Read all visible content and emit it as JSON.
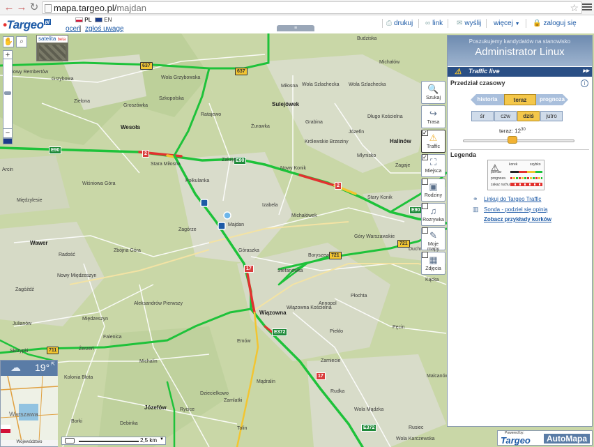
{
  "browser": {
    "url_host": "mapa.targeo.pl/",
    "url_path": "majdan"
  },
  "header": {
    "logo": "Targeo",
    "logo_suffix": "pl",
    "links": {
      "ocen": "oceń",
      "separator": "|",
      "uwagi": "zgłoś uwagę"
    },
    "lang_pl": "PL",
    "lang_en": "EN",
    "tools": {
      "print": "drukuj",
      "link": "link",
      "send": "wyślij",
      "more": "więcej",
      "login": "zaloguj się"
    },
    "collapse": "≡"
  },
  "map": {
    "satellite_label": "satelita",
    "satellite_new": "beta",
    "weather_temp": "19°",
    "weather_city": "Warszawa",
    "weather_caption": "Województwo",
    "scale": "2,5 km",
    "roads": {
      "e90_a": "E90",
      "e90_b": "E90",
      "e90_c": "E90",
      "r637a": "637",
      "r637b": "637",
      "r721a": "721",
      "r721b": "721",
      "r711": "711",
      "r17a": "17",
      "r17b": "17",
      "r2a": "2",
      "r2b": "2",
      "e372a": "E372",
      "e372b": "E372"
    },
    "places": {
      "nowy_rembertow": "Nowy Rembertów",
      "grzybowa": "Grzybowa",
      "zielona": "Zielona",
      "wola_grzybowska": "Wola Grzybowska",
      "szkopolska": "Szkopolska",
      "groszowka": "Groszówka",
      "wesola": "Wesoła",
      "ratajewo": "Ratajewo",
      "milosna": "Miłosna",
      "wola_szlachecka": "Wola Szlachecka",
      "sulejowek": "Sulejówek",
      "zurawka": "Żurawka",
      "budziska": "Budziska",
      "michalow": "Michałów",
      "dlugo": "Długo Kościelna",
      "grabina": "Grabina",
      "krolewskie": "Królewskie Brzeziny",
      "jozefin": "Józefin",
      "halinow": "Halinów",
      "mlynisko": "Mlynisko",
      "zagaje": "Zagaje",
      "stara_milosna": "Stara Miłosna",
      "zakret": "Zakręt",
      "nowy_konik": "Nowy Konik",
      "stary_konik": "Stary Konik",
      "wisniowa": "Wiśniowa Góra",
      "miedzylesie": "Międzylesie",
      "polkulanka": "Połkulanka",
      "izabela": "Izabela",
      "michalowek": "Michałówek",
      "majdan": "Majdan",
      "zagorze": "Zagórze",
      "wawer": "Wawer",
      "radosc": "Radość",
      "zbojna": "Zbójna Góra",
      "goraszka": "Góraszka",
      "gory": "Góry Warszawskie",
      "boryszew": "Boryszew",
      "duchnow": "Duchnów",
      "stefanowka": "Stefanówka",
      "nowy_miedzeszyn": "Nowy Międzeszyn",
      "zagozdz": "Zagóźdź",
      "aleksandrow": "Aleksandrów Pierwszy",
      "wiazowna": "Wiązowna",
      "wiazowna_k": "Wiązowna Kościelna",
      "annopol": "Annopol",
      "plochta": "Płochta",
      "kacka": "Kącka",
      "miedzeszyn": "Międzeszyn",
      "julianow": "Julianów",
      "emow": "Emów",
      "pieklo": "Piekło",
      "pecin": "Pęcin",
      "skrzypki": "Skrzypki",
      "falenica": "Falenica",
      "zerzen": "Żerzeń",
      "michalin": "Michalin",
      "kolonia": "Kolonia Błota",
      "zamiecie": "Zamiecie",
      "malcanow": "Malcanów",
      "madralin": "Mądralin",
      "dziecielkowo": "Dziecielkowo",
      "zamlatki": "Zamlatki",
      "rudka": "Rudka",
      "jozefow": "Józefów",
      "wola_mala": "Wola Mądzka",
      "rycice": "Rycice",
      "debinka": "Debinka",
      "rusiec": "Rusiec",
      "tolin": "Tolin",
      "wola_karczew": "Wola Karczewska",
      "borki": "Borki",
      "arcin": "Arcin"
    }
  },
  "layers": {
    "szukaj": "Szukaj",
    "trasa": "Trasa",
    "traffic": "Traffic",
    "miejsca": "Miejsca",
    "rodzinny": "Rodziny",
    "rozrywka": "Rozrywka",
    "moje_mapy": "Moje mapy",
    "zdjecia": "Zdjęcia"
  },
  "panel": {
    "ad_small": "Poszukujemy kandydatów na stanowisko",
    "ad_big": "Administrator Linux",
    "title": "Traffic live",
    "title_arrow": "▸▸",
    "przedzial": "Przedział czasowy",
    "help": "i",
    "mode_history": "historia",
    "mode_now": "teraz",
    "mode_forecast": "prognoza",
    "days": [
      "śr",
      "czw",
      "dziś",
      "jutro"
    ],
    "time_prefix": "teraz: 12",
    "time_sup": "30",
    "legend_title": "Legenda",
    "legend": {
      "korek": "korek",
      "szybko": "szybko",
      "pomiar": "pomiar",
      "prognoza": "prognoza",
      "zakaz": "zakaz ruchu"
    },
    "link_linkuj": "Linkuj do Targeo Traffic",
    "link_sonda": "Sonda - podziel się opinią",
    "link_zobacz": "Zobacz przykłady korków"
  },
  "powered": {
    "by": "Powered by:",
    "targeo": "Targeo",
    "automapa": "AutoMapa"
  }
}
